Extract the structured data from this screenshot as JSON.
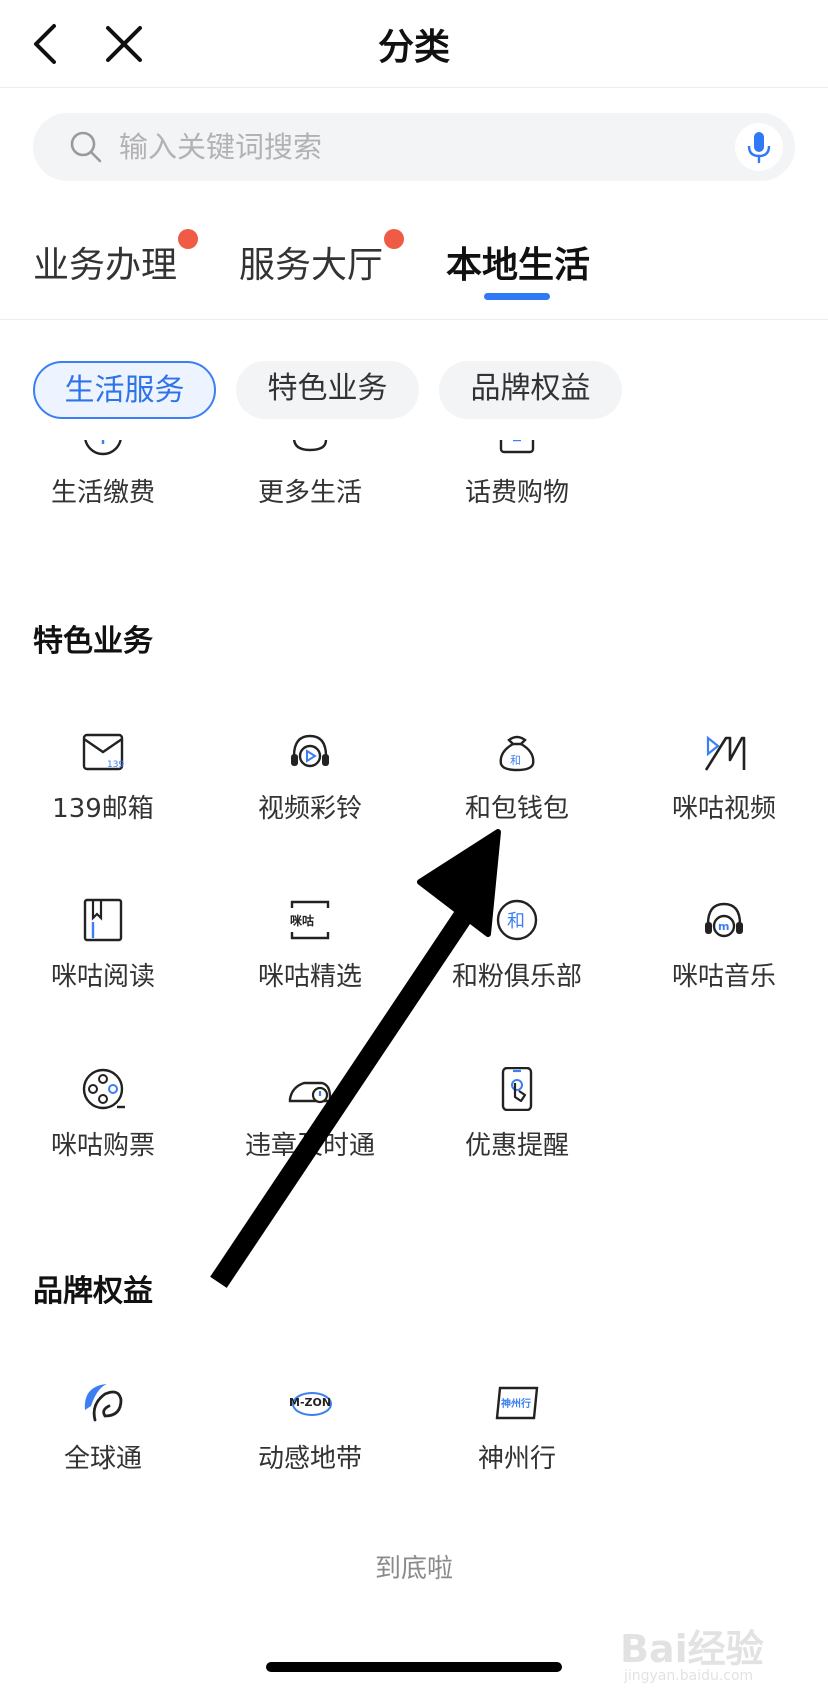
{
  "header": {
    "title": "分类",
    "back_icon": "chevron-left-icon",
    "close_icon": "close-icon"
  },
  "search": {
    "placeholder": "输入关键词搜索",
    "icon": "search-icon",
    "voice_icon": "microphone-icon"
  },
  "tabs": [
    {
      "label": "业务办理",
      "has_red_dot": true
    },
    {
      "label": "服务大厅",
      "has_red_dot": true
    },
    {
      "label": "本地生活",
      "active": true
    }
  ],
  "chips": [
    {
      "label": "生活服务",
      "active": true
    },
    {
      "label": "特色业务"
    },
    {
      "label": "品牌权益"
    }
  ],
  "life_services": {
    "items": [
      {
        "label": "生活缴费",
        "icon": "payment-icon"
      },
      {
        "label": "更多生活",
        "icon": "more-life-icon"
      },
      {
        "label": "话费购物",
        "icon": "shopping-icon"
      }
    ]
  },
  "featured": {
    "title": "特色业务",
    "items": [
      {
        "label": "139邮箱",
        "icon": "mail-139-icon",
        "badge": "139"
      },
      {
        "label": "视频彩铃",
        "icon": "video-ringtone-icon"
      },
      {
        "label": "和包钱包",
        "icon": "wallet-icon",
        "badge": "和"
      },
      {
        "label": "咪咕视频",
        "icon": "migu-video-icon"
      },
      {
        "label": "咪咕阅读",
        "icon": "migu-reading-icon"
      },
      {
        "label": "咪咕精选",
        "icon": "migu-selection-icon",
        "badge": "咪咕"
      },
      {
        "label": "和粉俱乐部",
        "icon": "fan-club-icon",
        "badge": "和"
      },
      {
        "label": "咪咕音乐",
        "icon": "migu-music-icon",
        "badge": "m"
      },
      {
        "label": "咪咕购票",
        "icon": "film-reel-icon"
      },
      {
        "label": "违章及时通",
        "icon": "car-alert-icon"
      },
      {
        "label": "优惠提醒",
        "icon": "phone-tap-icon"
      }
    ]
  },
  "brand": {
    "title": "品牌权益",
    "items": [
      {
        "label": "全球通",
        "icon": "global-pass-icon"
      },
      {
        "label": "动感地带",
        "icon": "mzone-icon",
        "badge": "M-ZONE"
      },
      {
        "label": "神州行",
        "icon": "shenzhouxing-icon",
        "badge": "神州行"
      }
    ]
  },
  "footer": {
    "end_text": "到底啦"
  },
  "watermark": {
    "logo": "Bai经验",
    "url": "jingyan.baidu.com"
  },
  "colors": {
    "accent": "#2f78f6",
    "red_dot": "#ef5b44",
    "chip_active_bg": "#eef4ff",
    "search_bg": "#f3f4f6"
  }
}
